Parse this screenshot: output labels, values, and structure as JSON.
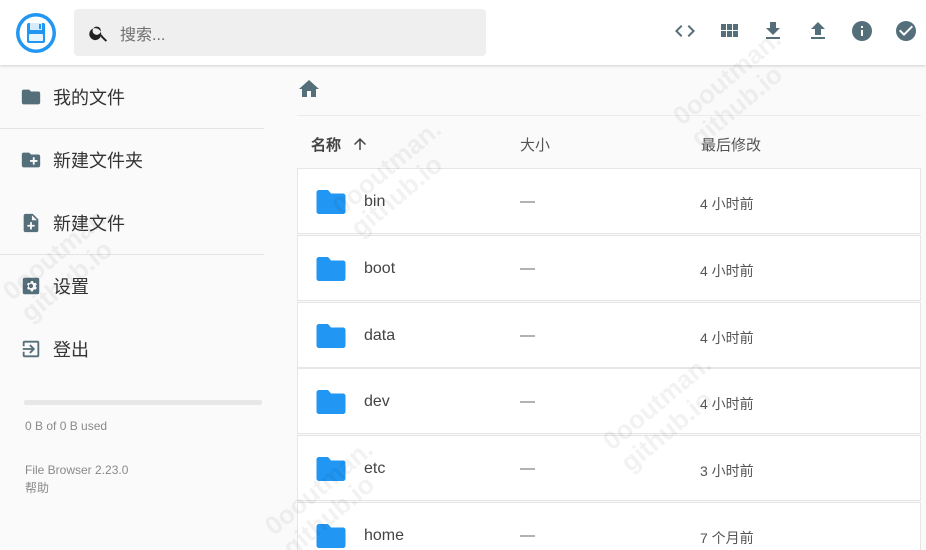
{
  "search": {
    "placeholder": "搜索..."
  },
  "header_actions": [
    {
      "name": "code-view-button",
      "icon": "code-icon"
    },
    {
      "name": "grid-view-button",
      "icon": "grid-icon"
    },
    {
      "name": "download-button",
      "icon": "download-icon"
    },
    {
      "name": "upload-button",
      "icon": "upload-icon"
    },
    {
      "name": "info-button",
      "icon": "info-icon"
    },
    {
      "name": "select-button",
      "icon": "check-circle-icon"
    }
  ],
  "sidebar": {
    "items": [
      {
        "label": "我的文件",
        "icon": "folder-icon"
      },
      {
        "label": "新建文件夹",
        "icon": "create-folder-icon"
      },
      {
        "label": "新建文件",
        "icon": "note-add-icon"
      },
      {
        "label": "设置",
        "icon": "settings-icon"
      },
      {
        "label": "登出",
        "icon": "exit-icon"
      }
    ],
    "usage_text": "0 B of 0 B used",
    "usage_fraction": 0,
    "version": "File Browser 2.23.0",
    "help": "帮助"
  },
  "listing": {
    "columns": {
      "name": "名称",
      "size": "大小",
      "modified": "最后修改"
    },
    "sort_icon": "arrow-up-icon",
    "rows": [
      {
        "name": "bin",
        "size": "—",
        "modified": "4 小时前"
      },
      {
        "name": "boot",
        "size": "—",
        "modified": "4 小时前"
      },
      {
        "name": "data",
        "size": "—",
        "modified": "4 小时前"
      },
      {
        "name": "dev",
        "size": "—",
        "modified": "4 小时前"
      },
      {
        "name": "etc",
        "size": "—",
        "modified": "3 小时前"
      },
      {
        "name": "home",
        "size": "—",
        "modified": "7 个月前"
      }
    ]
  },
  "watermark": {
    "line1": "0ooutman.",
    "line2": "github.io"
  },
  "colors": {
    "accent": "#2196f3",
    "icon": "#546e7a",
    "folder": "#2196f3"
  }
}
